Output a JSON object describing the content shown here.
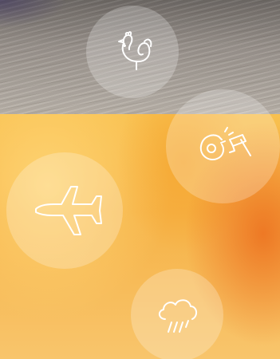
{
  "background": {
    "top_texture": "wood-photo",
    "bottom_color": "#f6b246",
    "accent_color": "#ec6e1e"
  },
  "circles": [
    {
      "icon": "rooster-icon"
    },
    {
      "icon": "saw-blade-hammer-icon"
    },
    {
      "icon": "airplane-icon"
    },
    {
      "icon": "rain-cloud-icon"
    }
  ],
  "icon_color": "#ffffff"
}
